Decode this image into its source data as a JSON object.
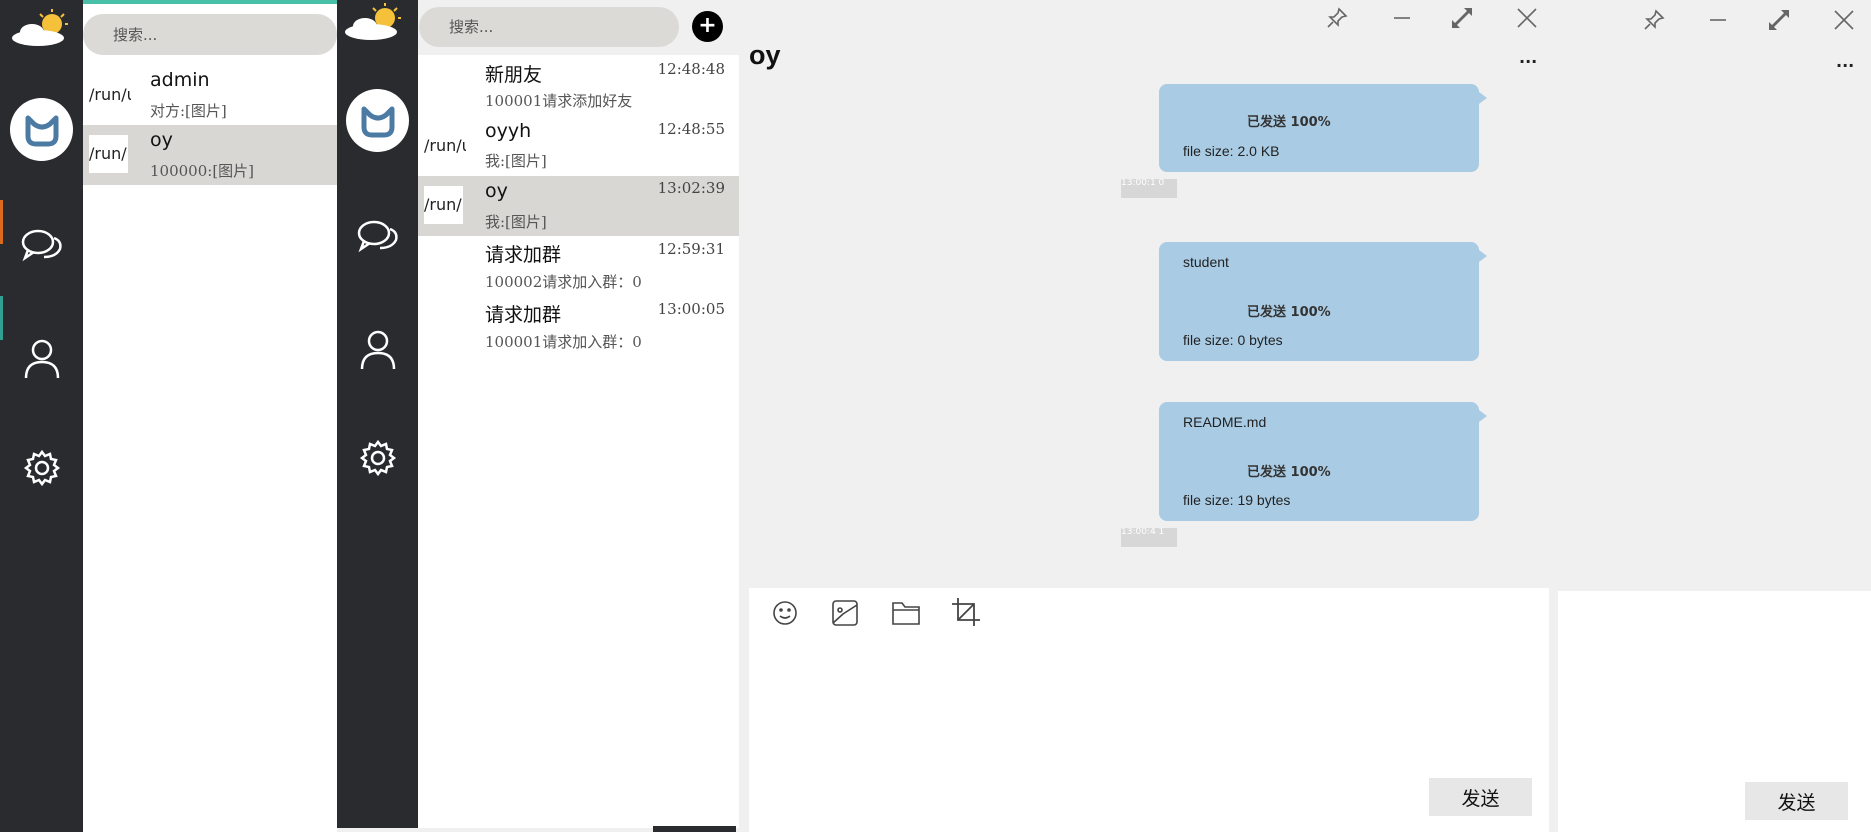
{
  "window": {
    "chat_title": "oy",
    "more": "...",
    "more_right": "..."
  },
  "left_window": {
    "search_placeholder": "搜索...",
    "rows": [
      {
        "thumb": "/run/user",
        "name": "admin",
        "sub": "对方:[图片]"
      },
      {
        "thumb": "/run/user",
        "name": "oy",
        "sub": "100000:[图片]"
      }
    ]
  },
  "middle_window": {
    "search_placeholder": "搜索...",
    "add_symbol": "+",
    "rows": [
      {
        "thumb": "",
        "name": "新朋友",
        "sub": "100001请求添加好友",
        "time": "12:48:48"
      },
      {
        "thumb": "/run/user",
        "name": "oyyh",
        "sub": "我:[图片]",
        "time": "12:48:55"
      },
      {
        "thumb": "/run/user",
        "name": "oy",
        "sub": "我:[图片]",
        "time": "13:02:39"
      },
      {
        "thumb": "",
        "name": "请求加群",
        "sub": "100002请求加入群：0",
        "time": "12:59:31"
      },
      {
        "thumb": "",
        "name": "请求加群",
        "sub": "100001请求加入群：0",
        "time": "13:00:05"
      }
    ]
  },
  "messages": [
    {
      "filename": "",
      "status": "已发送 100%",
      "size": "file size: 2.0 KB"
    },
    {
      "filename": "student",
      "status": "已发送 100%",
      "size": "file size: 0 bytes"
    },
    {
      "filename": "README.md",
      "status": "已发送 100%",
      "size": "file size: 19 bytes"
    }
  ],
  "timestamps": [
    "13:00:1 0",
    "13:00:4 1"
  ],
  "composer": {
    "send_label": "发送",
    "send_label_right": "发送"
  },
  "icons": {
    "weather": "weather-sun-cloud-icon",
    "chat": "chat-bubbles-icon",
    "contacts": "person-icon",
    "settings": "gear-icon",
    "pin": "pin-icon",
    "minimize": "minimize-icon",
    "maximize": "maximize-icon",
    "close": "close-icon",
    "emoji": "emoji-icon",
    "image": "image-icon",
    "folder": "folder-icon",
    "crop": "crop-icon"
  },
  "colors": {
    "sidebar": "#2a2b2f",
    "bubble": "#a9cce4",
    "selected_row": "#d9d7d4",
    "accent_teal": "#48c0a8"
  }
}
